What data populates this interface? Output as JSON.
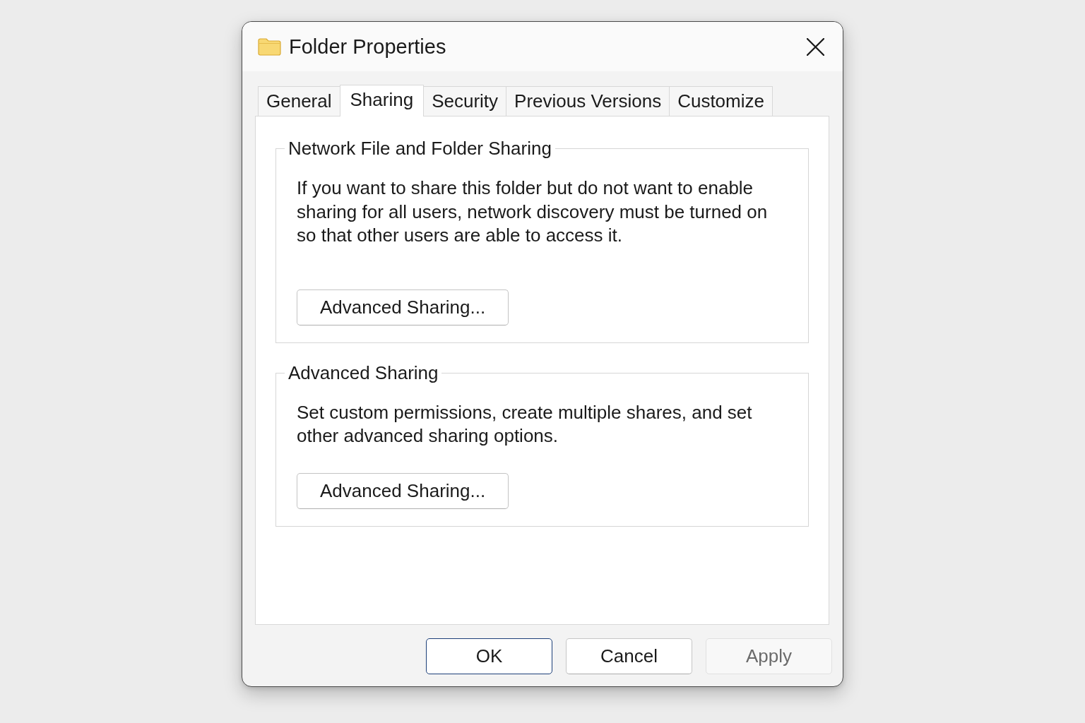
{
  "window": {
    "title": "Folder Properties"
  },
  "tabs": [
    {
      "label": "General",
      "selected": false
    },
    {
      "label": "Sharing",
      "selected": true
    },
    {
      "label": "Security",
      "selected": false
    },
    {
      "label": "Previous Versions",
      "selected": false
    },
    {
      "label": "Customize",
      "selected": false
    }
  ],
  "groups": [
    {
      "title": "Network File and Folder Sharing",
      "text": "If you want to share this folder but do not want to enable sharing for all users, network discovery must be turned on so that other users are able to access it.",
      "button": "Advanced Sharing..."
    },
    {
      "title": "Advanced Sharing",
      "text": "Set custom permissions, create multiple shares, and set other advanced sharing options.",
      "button": "Advanced Sharing..."
    }
  ],
  "buttons": [
    {
      "label": "OK",
      "default": true,
      "disabled": false
    },
    {
      "label": "Cancel",
      "default": false,
      "disabled": false
    },
    {
      "label": "Apply",
      "default": false,
      "disabled": true
    }
  ]
}
